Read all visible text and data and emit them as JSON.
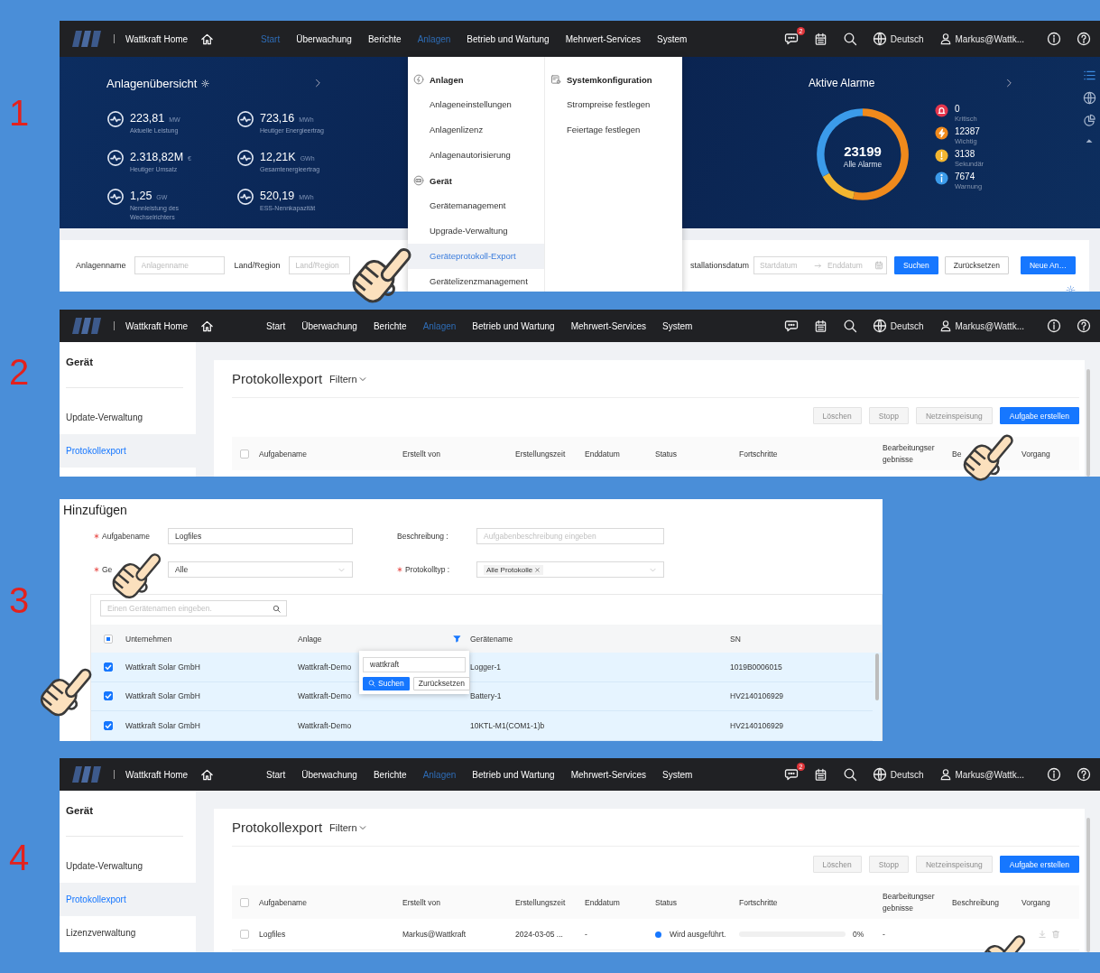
{
  "steps": [
    {
      "kind": "dashboard",
      "number": "1",
      "nav": {
        "title": "Wattkraft Home",
        "menu": [
          {
            "label": "Start",
            "selected": true
          },
          {
            "label": "Überwachung",
            "selected": false
          },
          {
            "label": "Berichte",
            "selected": false
          },
          {
            "label": "Anlagen",
            "selected": true
          },
          {
            "label": "Betrieb und Wartung",
            "selected": false
          },
          {
            "label": "Mehrwert-Services",
            "selected": false
          },
          {
            "label": "System",
            "selected": false
          }
        ],
        "message_badge": "2",
        "language": "Deutsch",
        "user": "Markus@Wattk..."
      },
      "overview": {
        "title": "Anlagenübersicht",
        "metrics": [
          {
            "value": "223,81",
            "unit": "MW",
            "label": "Aktuelle Leistung"
          },
          {
            "value": "723,16",
            "unit": "MWh",
            "label": "Heutiger Energieertrag"
          },
          {
            "value": "2.318,82M",
            "unit": "€",
            "label": "Heutiger Umsatz"
          },
          {
            "value": "12,21K",
            "unit": "GWh",
            "label": "Gesamtenergieertrag"
          },
          {
            "value": "1,25",
            "unit": "GW",
            "label": "Nennleistung des Wechselrichters"
          },
          {
            "value": "520,19",
            "unit": "MWh",
            "label": "ESS-Nennkapazität"
          }
        ]
      },
      "alarms": {
        "title": "Aktive Alarme",
        "total": "23199",
        "total_label": "Alle Alarme",
        "items": [
          {
            "count": "0",
            "label": "Kritisch",
            "color": "#e5364d"
          },
          {
            "count": "12387",
            "label": "Wichtig",
            "color": "#f08a1c"
          },
          {
            "count": "3138",
            "label": "Sekundär",
            "color": "#f2b630"
          },
          {
            "count": "7674",
            "label": "Warnung",
            "color": "#3b9bea"
          }
        ]
      },
      "filters": {
        "fields": [
          {
            "label": "Anlagenname",
            "placeholder": "Anlagenname"
          },
          {
            "label": "Land/Region",
            "placeholder": "Land/Region"
          }
        ],
        "date_label": "stallationsdatum",
        "date_range": {
          "start_placeholder": "Startdatum",
          "end_placeholder": "Enddatum"
        },
        "buttons": [
          {
            "label": "Suchen",
            "kind": "primary"
          },
          {
            "label": "Zurücksetzen",
            "kind": "default"
          },
          {
            "label": "Neue An…",
            "kind": "primary"
          }
        ]
      },
      "dropdown": {
        "columns": [
          {
            "groups": [
              {
                "heading": "Anlagen",
                "items": [
                  {
                    "label": "Anlageneinstellungen",
                    "selected": false
                  },
                  {
                    "label": "Anlagenlizenz",
                    "selected": false
                  },
                  {
                    "label": "Anlagenautorisierung",
                    "selected": false
                  }
                ]
              },
              {
                "heading": "Gerät",
                "items": [
                  {
                    "label": "Gerätemanagement",
                    "selected": false
                  },
                  {
                    "label": "Upgrade-Verwaltung",
                    "selected": false
                  },
                  {
                    "label": "Geräteprotokoll-Export",
                    "selected": true
                  },
                  {
                    "label": "Gerätelizenzmanagement",
                    "selected": false
                  }
                ]
              }
            ]
          },
          {
            "groups": [
              {
                "heading": "Systemkonfiguration",
                "items": [
                  {
                    "label": "Strompreise festlegen",
                    "selected": false
                  },
                  {
                    "label": "Feiertage festlegen",
                    "selected": false
                  }
                ]
              }
            ]
          }
        ]
      }
    },
    {
      "kind": "log-list",
      "number": "2",
      "nav": {
        "title": "Wattkraft Home",
        "menu": [
          {
            "label": "Start",
            "selected": false
          },
          {
            "label": "Überwachung",
            "selected": false
          },
          {
            "label": "Berichte",
            "selected": false
          },
          {
            "label": "Anlagen",
            "selected": true
          },
          {
            "label": "Betrieb und Wartung",
            "selected": false
          },
          {
            "label": "Mehrwert-Services",
            "selected": false
          },
          {
            "label": "System",
            "selected": false
          }
        ],
        "language": "Deutsch",
        "user": "Markus@Wattk..."
      },
      "sidebar": {
        "title": "Gerät",
        "items": [
          {
            "label": "Update-Verwaltung",
            "selected": false
          },
          {
            "label": "Protokollexport",
            "selected": true
          }
        ]
      },
      "title": "Protokollexport",
      "filter": "Filtern",
      "actions": [
        {
          "label": "Löschen",
          "disabled": true
        },
        {
          "label": "Stopp",
          "disabled": true
        },
        {
          "label": "Netzeinspeisung",
          "disabled": true
        },
        {
          "label": "Aufgabe erstellen",
          "disabled": false
        }
      ],
      "select_all": false,
      "columns": [
        "Aufgabename",
        "Erstellt von",
        "Erstellungszeit",
        "Enddatum",
        "Status",
        "Fortschritte",
        "Bearbeitungsergebnisse",
        "Be",
        "Vorgang"
      ]
    },
    {
      "kind": "add-dialog",
      "number": "3",
      "title": "Hinzufügen",
      "fields": [
        {
          "kind": "input",
          "label": "Aufgabename",
          "required": true,
          "value": "Logfiles"
        },
        {
          "kind": "input",
          "label": "Beschreibung :",
          "required": false,
          "placeholder": "Aufgabenbeschreibung eingeben"
        },
        {
          "kind": "select",
          "label": "Ge",
          "required": true,
          "value": "Alle"
        },
        {
          "kind": "tags",
          "label": "Protokolltyp :",
          "required": true,
          "tags": [
            "Alle Protokolle"
          ]
        }
      ],
      "device_table": {
        "search_placeholder": "Einen Gerätenamen eingeben.",
        "select_all_partial": true,
        "columns": [
          {
            "label": "Unternehmen",
            "filtered": false
          },
          {
            "label": "Anlage",
            "filtered": true
          },
          {
            "label": "Gerätename",
            "filtered": false
          },
          {
            "label": "SN",
            "filtered": false
          }
        ],
        "rows": [
          {
            "checked": true,
            "cells": [
              "Wattkraft Solar GmbH",
              "Wattkraft-Demo",
              "Logger-1",
              "1019B0006015"
            ]
          },
          {
            "checked": true,
            "cells": [
              "Wattkraft Solar GmbH",
              "Wattkraft-Demo",
              "Battery-1",
              "HV2140106929"
            ]
          },
          {
            "checked": true,
            "cells": [
              "Wattkraft Solar GmbH",
              "Wattkraft-Demo",
              "10KTL-M1(COM1-1)b",
              "HV2140106929"
            ]
          }
        ],
        "filter_popup": {
          "value": "wattkraft",
          "buttons": [
            "Suchen",
            "Zurücksetzen"
          ]
        }
      }
    },
    {
      "kind": "log-list",
      "number": "4",
      "nav": {
        "title": "Wattkraft Home",
        "menu": [
          {
            "label": "Start",
            "selected": false
          },
          {
            "label": "Überwachung",
            "selected": false
          },
          {
            "label": "Berichte",
            "selected": false
          },
          {
            "label": "Anlagen",
            "selected": true
          },
          {
            "label": "Betrieb und Wartung",
            "selected": false
          },
          {
            "label": "Mehrwert-Services",
            "selected": false
          },
          {
            "label": "System",
            "selected": false
          }
        ],
        "message_badge": "2",
        "language": "Deutsch",
        "user": "Markus@Wattk..."
      },
      "sidebar": {
        "title": "Gerät",
        "items": [
          {
            "label": "Update-Verwaltung",
            "selected": false
          },
          {
            "label": "Protokollexport",
            "selected": true
          },
          {
            "label": "Lizenzverwaltung",
            "selected": false
          }
        ]
      },
      "title": "Protokollexport",
      "filter": "Filtern",
      "actions": [
        {
          "label": "Löschen",
          "disabled": true
        },
        {
          "label": "Stopp",
          "disabled": true
        },
        {
          "label": "Netzeinspeisung",
          "disabled": true
        },
        {
          "label": "Aufgabe erstellen",
          "disabled": false
        }
      ],
      "select_all": false,
      "columns": [
        "Aufgabename",
        "Erstellt von",
        "Erstellungszeit",
        "Enddatum",
        "Status",
        "Fortschritte",
        "Bearbeitungsergebnisse",
        "Beschreibung",
        "Vorgang"
      ],
      "rows": [
        {
          "checked": false,
          "name": "Logfiles",
          "creator": "Markus@Wattkraft",
          "created": "2024-03-05 ...",
          "end_date": "-",
          "status": {
            "label": "Wird ausgeführt.",
            "color": "#1677ff"
          },
          "progress": {
            "level": 0,
            "reading": "0%"
          },
          "result": "-"
        }
      ]
    }
  ]
}
